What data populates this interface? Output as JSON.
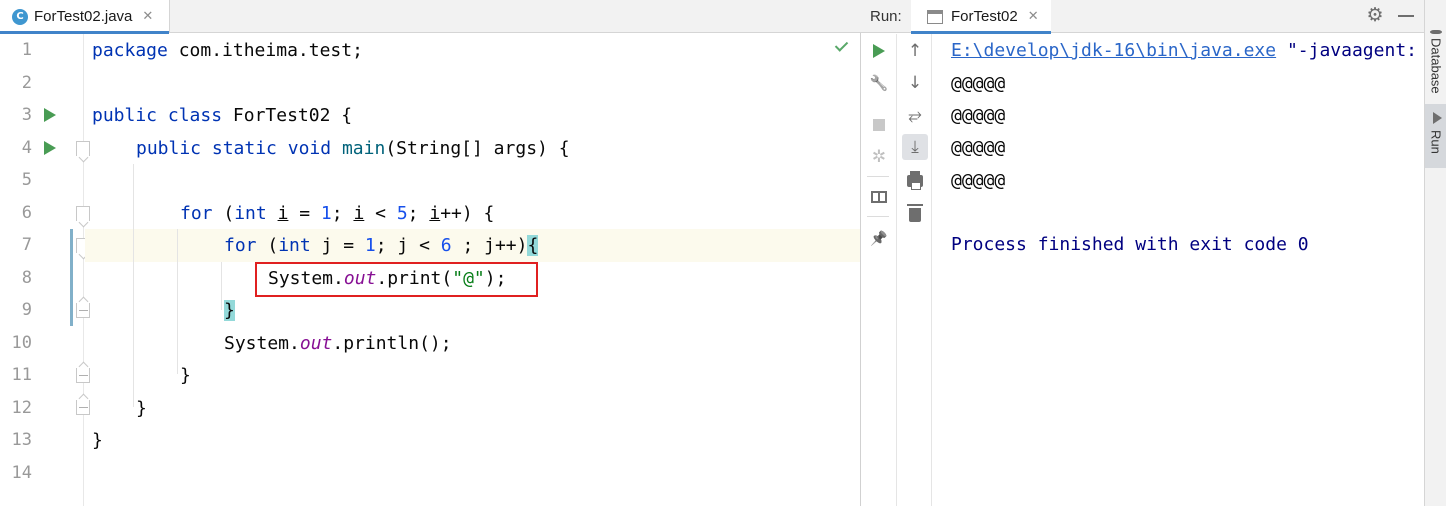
{
  "editor": {
    "tab": {
      "icon_letter": "C",
      "filename": "ForTest02.java",
      "close": "✕"
    },
    "line_numbers": [
      "1",
      "2",
      "3",
      "4",
      "5",
      "6",
      "7",
      "8",
      "9",
      "10",
      "11",
      "12",
      "13",
      "14"
    ],
    "code": {
      "l1_kw": "package",
      "l1_rest": " com.itheima.test;",
      "l3_kw1": "public",
      "l3_kw2": "class",
      "l3_rest": " ForTest02 {",
      "l4_kw1": "public",
      "l4_kw2": "static",
      "l4_kw3": "void",
      "l4_meth": "main",
      "l4_rest": "(String[] args) {",
      "l6_for": "for",
      "l6_open": " (",
      "l6_int": "int",
      "l6_sp": " ",
      "l6_i1": "i",
      "l6_eq": " = ",
      "l6_n1": "1",
      "l6_semi1": "; ",
      "l6_i2": "i",
      "l6_lt": " < ",
      "l6_n5": "5",
      "l6_semi2": "; ",
      "l6_i3": "i",
      "l6_tail": "++) {",
      "l7_for": "for",
      "l7_open": " (",
      "l7_int": "int",
      "l7_j": " j = ",
      "l7_n1": "1",
      "l7_mid": "; j < ",
      "l7_n6": "6",
      "l7_tail": " ; j++)",
      "l7_brace": "{",
      "l8_sys": "System.",
      "l8_out": "out",
      "l8_print": ".print(",
      "l8_str": "\"@\"",
      "l8_end": ");",
      "l9_brace": "}",
      "l10_sys": "System.",
      "l10_out": "out",
      "l10_println": ".println();",
      "l11": "}",
      "l12": "}",
      "l13": "}"
    }
  },
  "run_panel": {
    "label": "Run:",
    "tab": {
      "name": "ForTest02",
      "close": "✕"
    },
    "gear": "⚙",
    "console": {
      "java_path": "E:\\develop\\jdk-16\\bin\\java.exe",
      "java_args": " \"-javaagent:",
      "output_lines": [
        "@@@@@",
        "@@@@@",
        "@@@@@",
        "@@@@@"
      ],
      "exit_message": "Process finished with exit code 0"
    },
    "toolbar": {
      "wrench": "🔧",
      "debug": "✲",
      "pin": "📌",
      "up": "↑",
      "down": "↓",
      "wrap": "⥂",
      "scroll_end": "⤓"
    }
  },
  "side_strip": {
    "database": "Database",
    "run": "Run"
  },
  "colors": {
    "accent": "#4083c9",
    "keyword": "#0033b3",
    "string": "#067d17",
    "highlight_box": "#e02020",
    "run_green": "#499c54"
  }
}
